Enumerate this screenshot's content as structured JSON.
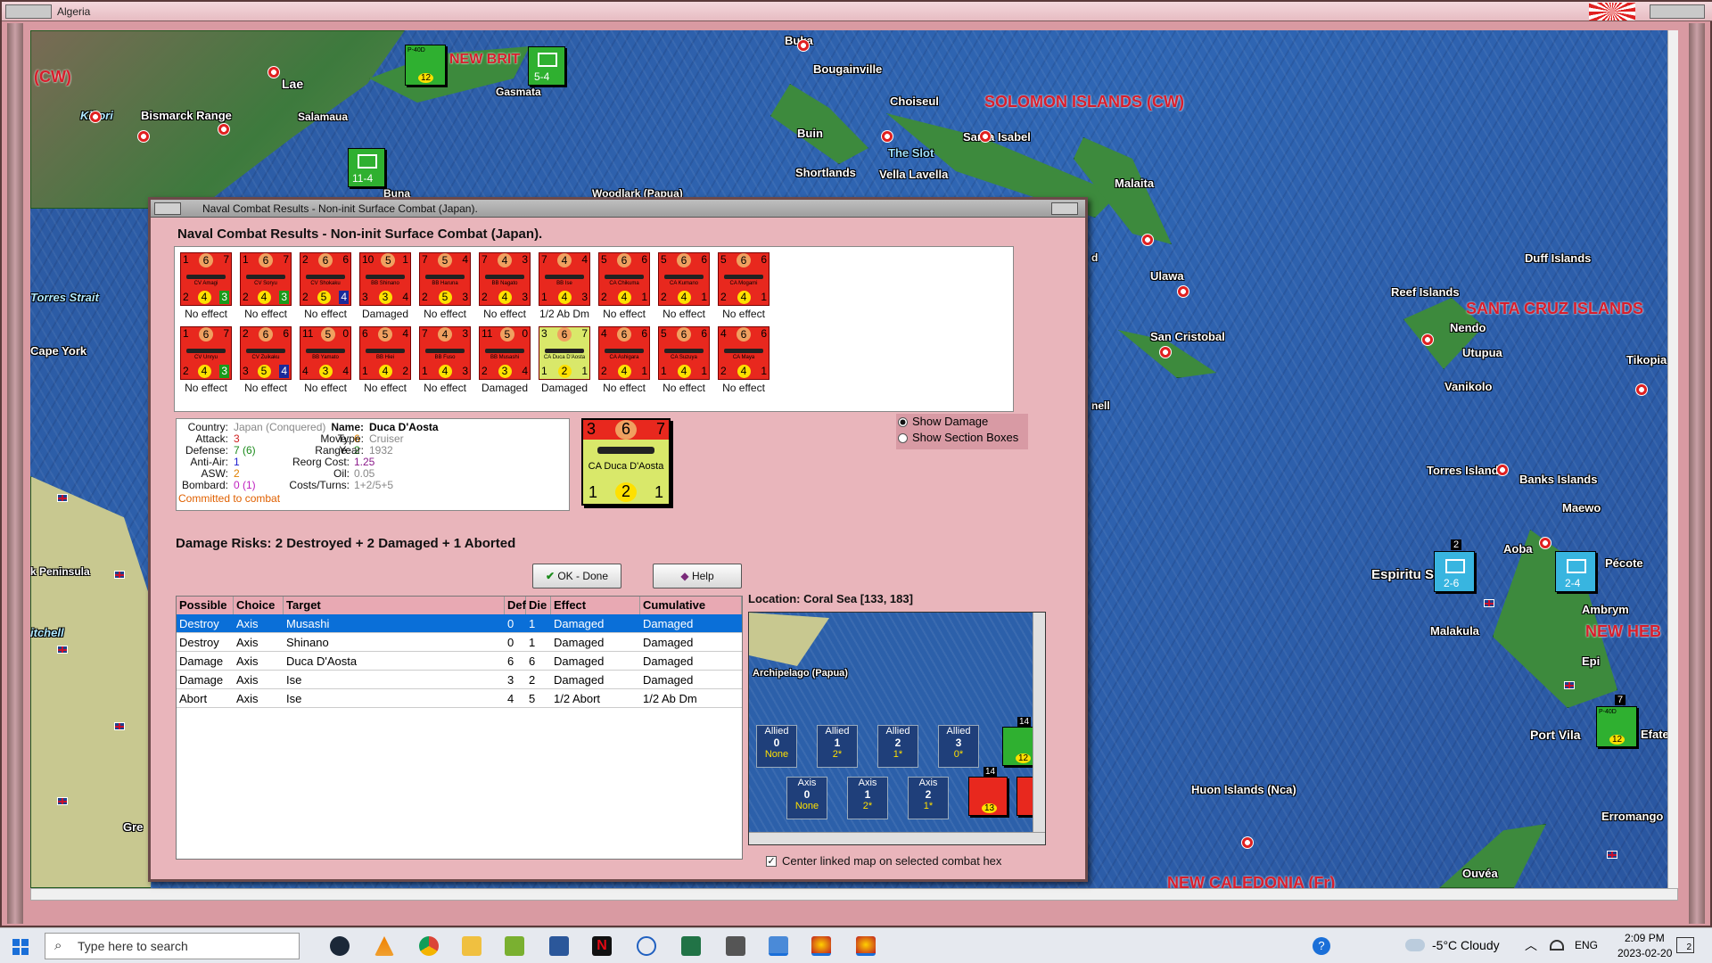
{
  "app": {
    "window_title": "Algeria"
  },
  "map_labels": {
    "solomon": "SOLOMON ISLANDS (CW)",
    "santacruz": "SANTA CRUZ ISLANDS",
    "newheb": "NEW HEB",
    "newcal": "NEW CALEDONIA (Fr)",
    "newbrit": "NEW BRIT",
    "cw": "(CW)",
    "buka": "Buka",
    "bougainville": "Bougainville",
    "choiseul": "Choiseul",
    "santaisabel": "Santa Isabel",
    "theslot": "The Slot",
    "buin": "Buin",
    "shortlands": "Shortlands",
    "vellalavella": "Vella Lavella",
    "malaita": "Malaita",
    "ulawa": "Ulawa",
    "sancristobal": "San Cristobal",
    "duff": "Duff Islands",
    "reef": "Reef Islands",
    "nendo": "Nendo",
    "utupua": "Utupua",
    "vanikolo": "Vanikolo",
    "tikopia": "Tikopia",
    "torres": "Torres Islands",
    "banks": "Banks Islands",
    "maewo": "Maewo",
    "aoba": "Aoba",
    "pecote": "Pécote",
    "espiritu": "Espiritu S",
    "ambrym": "Ambrym",
    "malakula": "Malakula",
    "epi": "Epi",
    "portvila": "Port Vila",
    "efate": "Efate",
    "erromango": "Erromango",
    "huon": "Huon Islands (Nca)",
    "ouvea": "Ouvéa",
    "lae": "Lae",
    "salamaua": "Salamaua",
    "kikori": "Kikori",
    "bismarck": "Bismarck Range",
    "gasmata": "Gasmata",
    "buna": "Buna",
    "woodlark": "Woodlark (Papua)",
    "torresstrait": "Torres Strait",
    "capeyork": "Cape York",
    "peninsula": "k Peninsula",
    "mitchell": "itchell",
    "gre": "Gre",
    "nell": "nell",
    "d": "d"
  },
  "map_counters": {
    "c1_bottom": "12",
    "c1_top": "P-40D",
    "c2": "5-4",
    "c3": "11-4",
    "c4_stack": "2",
    "c4": "2-6",
    "c5": "2-4",
    "c6_stack": "7",
    "c6_bottom": "12",
    "c6_top": "P-40D"
  },
  "dialog": {
    "title": "Naval Combat Results - Non-init Surface Combat (Japan).",
    "heading": "Naval Combat Results - Non-init Surface Combat (Japan).",
    "damage_risks": "Damage Risks:  2 Destroyed + 2 Damaged + 1 Aborted",
    "ok_label": "OK - Done",
    "help_label": "Help",
    "location": "Location:  Coral Sea [133, 183]",
    "center_linked": "Center linked map on selected combat hex",
    "show_damage": "Show Damage",
    "show_sections": "Show Section Boxes"
  },
  "ships_row1": [
    {
      "t": [
        "1",
        "6",
        "7"
      ],
      "name": "CV Amagi",
      "b": [
        "2",
        "4",
        "3"
      ],
      "bs": "g",
      "result": "No effect"
    },
    {
      "t": [
        "1",
        "6",
        "7"
      ],
      "name": "CV Soryu",
      "b": [
        "2",
        "4",
        "3"
      ],
      "bs": "g",
      "result": "No effect"
    },
    {
      "t": [
        "2",
        "6",
        "6"
      ],
      "name": "CV Shokaku",
      "b": [
        "2",
        "5",
        "4"
      ],
      "bs": "bl",
      "result": "No effect"
    },
    {
      "t": [
        "10",
        "5",
        "1"
      ],
      "name": "BB Shinano",
      "b": [
        "3",
        "3",
        "4"
      ],
      "bs": "",
      "result": "Damaged"
    },
    {
      "t": [
        "7",
        "5",
        "4"
      ],
      "name": "BB Haruna",
      "b": [
        "2",
        "5",
        "3"
      ],
      "bs": "",
      "result": "No effect"
    },
    {
      "t": [
        "7",
        "4",
        "3"
      ],
      "name": "BB Nagato",
      "b": [
        "2",
        "4",
        "3"
      ],
      "bs": "",
      "result": "No effect"
    },
    {
      "t": [
        "7",
        "4",
        "4"
      ],
      "name": "BB Ise",
      "b": [
        "1",
        "4",
        "3"
      ],
      "bs": "",
      "result": "1/2 Ab Dm"
    },
    {
      "t": [
        "5",
        "6",
        "6"
      ],
      "name": "CA Chikuma",
      "b": [
        "2",
        "4",
        "1"
      ],
      "bs": "",
      "result": "No effect"
    },
    {
      "t": [
        "5",
        "6",
        "6"
      ],
      "name": "CA Kumano",
      "b": [
        "2",
        "4",
        "1"
      ],
      "bs": "",
      "result": "No effect"
    },
    {
      "t": [
        "5",
        "6",
        "6"
      ],
      "name": "CA Mogami",
      "b": [
        "2",
        "4",
        "1"
      ],
      "bs": "",
      "result": "No effect"
    }
  ],
  "ships_row2": [
    {
      "t": [
        "1",
        "6",
        "7"
      ],
      "name": "CV Unryu",
      "b": [
        "2",
        "4",
        "3"
      ],
      "bs": "g",
      "result": "No effect",
      "y": false
    },
    {
      "t": [
        "2",
        "6",
        "6"
      ],
      "name": "CV Zuikaku",
      "b": [
        "3",
        "5",
        "4"
      ],
      "bs": "bl",
      "result": "No effect",
      "y": false
    },
    {
      "t": [
        "11",
        "5",
        "0"
      ],
      "name": "BB Yamato",
      "b": [
        "4",
        "3",
        "4"
      ],
      "bs": "",
      "result": "No effect",
      "y": false
    },
    {
      "t": [
        "6",
        "5",
        "4"
      ],
      "name": "BB Hiei",
      "b": [
        "1",
        "4",
        "2"
      ],
      "bs": "",
      "result": "No effect",
      "y": false
    },
    {
      "t": [
        "7",
        "4",
        "3"
      ],
      "name": "BB Fuso",
      "b": [
        "1",
        "4",
        "3"
      ],
      "bs": "",
      "result": "No effect",
      "y": false
    },
    {
      "t": [
        "11",
        "5",
        "0"
      ],
      "name": "BB Musashi",
      "b": [
        "2",
        "3",
        "4"
      ],
      "bs": "",
      "result": "Damaged",
      "y": false
    },
    {
      "t": [
        "3",
        "6",
        "7"
      ],
      "name": "CA Duca D'Aosta",
      "b": [
        "1",
        "2",
        "1"
      ],
      "bs": "",
      "result": "Damaged",
      "y": true
    },
    {
      "t": [
        "4",
        "6",
        "6"
      ],
      "name": "CA Ashigara",
      "b": [
        "2",
        "4",
        "1"
      ],
      "bs": "",
      "result": "No effect",
      "y": false
    },
    {
      "t": [
        "5",
        "6",
        "6"
      ],
      "name": "CA Suzuya",
      "b": [
        "1",
        "4",
        "1"
      ],
      "bs": "",
      "result": "No effect",
      "y": false
    },
    {
      "t": [
        "4",
        "6",
        "6"
      ],
      "name": "CA Maya",
      "b": [
        "2",
        "4",
        "1"
      ],
      "bs": "",
      "result": "No effect",
      "y": false
    }
  ],
  "info": {
    "country_label": "Country:",
    "country": "Japan (Conquered)",
    "attack_label": "Attack:",
    "attack": "3",
    "defense_label": "Defense:",
    "defense": "7 (6)",
    "aa_label": "Anti-Air:",
    "aa": "1",
    "asw_label": "ASW:",
    "asw": "2",
    "bombard_label": "Bombard:",
    "bombard": "0 (1)",
    "committed": "Committed to combat",
    "move_label": "Move:",
    "move": "6",
    "range_label": "Range:",
    "range": "2",
    "reorg_label": "Reorg Cost:",
    "reorg": "1.25",
    "oil_label": "Oil:",
    "oil": "0.05",
    "costs_label": "Costs/Turns:",
    "costs": "1+2/5+5",
    "name_label": "Name:",
    "name": "Duca D'Aosta",
    "type_label": "Type:",
    "type": "Cruiser",
    "year_label": "Year:",
    "year": "1932"
  },
  "big_counter": {
    "t": [
      "3",
      "6",
      "7"
    ],
    "name": "CA Duca D'Aosta",
    "b": [
      "1",
      "2",
      "1"
    ]
  },
  "table": {
    "headers": [
      "Possible",
      "Choice",
      "Target",
      "Def",
      "Die",
      "Effect",
      "Cumulative"
    ],
    "rows": [
      [
        "Destroy",
        "Axis",
        "Musashi",
        "0",
        "1",
        "Damaged",
        "Damaged"
      ],
      [
        "Destroy",
        "Axis",
        "Shinano",
        "0",
        "1",
        "Damaged",
        "Damaged"
      ],
      [
        "Damage",
        "Axis",
        "Duca D'Aosta",
        "6",
        "6",
        "Damaged",
        "Damaged"
      ],
      [
        "Damage",
        "Axis",
        "Ise",
        "3",
        "2",
        "Damaged",
        "Damaged"
      ],
      [
        "Abort",
        "Axis",
        "Ise",
        "4",
        "5",
        "1/2 Abort",
        "1/2 Ab Dm"
      ]
    ]
  },
  "minimap": {
    "label": "Archipelago (Papua)",
    "allied": [
      {
        "name": "Allied",
        "n": "0",
        "v": "None"
      },
      {
        "name": "Allied",
        "n": "1",
        "v": "2*"
      },
      {
        "name": "Allied",
        "n": "2",
        "v": "1*"
      },
      {
        "name": "Allied",
        "n": "3",
        "v": "0*"
      }
    ],
    "axis": [
      {
        "name": "Axis",
        "n": "0",
        "v": "None"
      },
      {
        "name": "Axis",
        "n": "1",
        "v": "2*"
      },
      {
        "name": "Axis",
        "n": "2",
        "v": "1*"
      }
    ],
    "allied_stack": "14",
    "allied_counter": "12",
    "axis_stack": "14",
    "axis_counter": "13"
  },
  "taskbar": {
    "search_placeholder": "Type here to search",
    "weather": "-5°C  Cloudy",
    "lang": "ENG",
    "time": "2:09 PM",
    "date": "2023-02-20",
    "notif": "2"
  },
  "colors": {
    "dialog_bg": "#e9b5bb",
    "selected_row": "#0a6fd8",
    "ship_red": "#e8281e",
    "ship_yellow": "#d9e86a"
  }
}
